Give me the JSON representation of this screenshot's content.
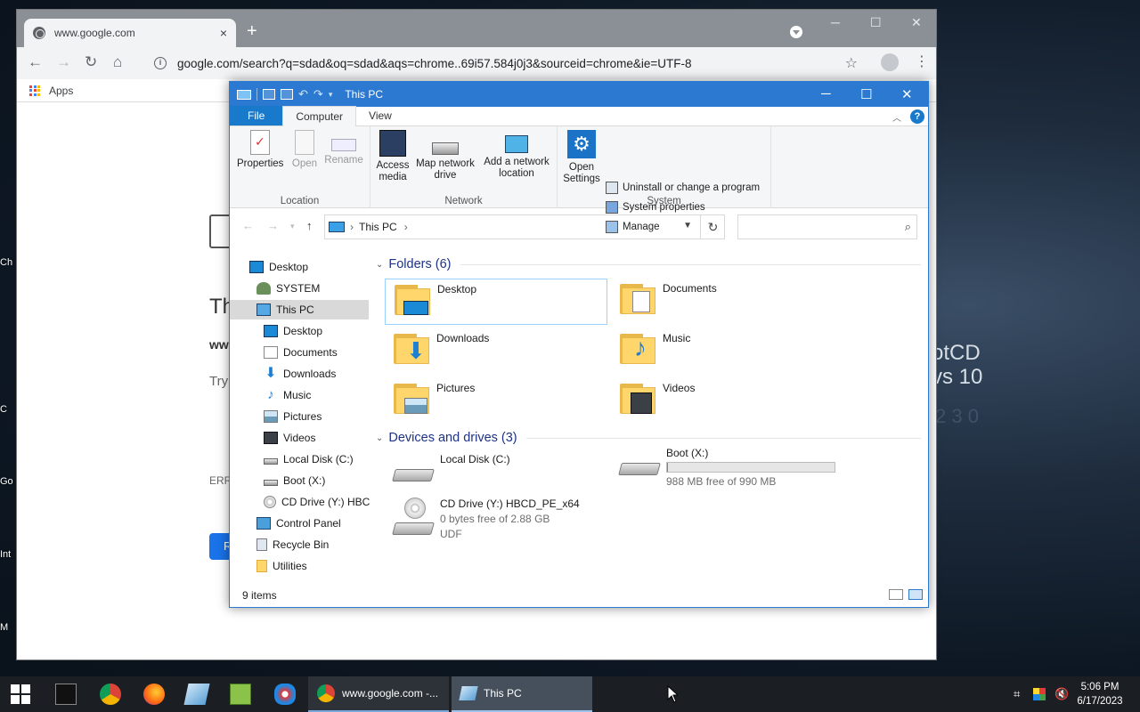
{
  "desktop": {
    "left_labels": [
      "Ch",
      "C",
      "Go",
      "Int",
      "M"
    ],
    "watermark_line1": "otCD",
    "watermark_line2": "vs 10",
    "faint_text": "2 3 0"
  },
  "chrome": {
    "tab_title": "www.google.com",
    "tab_close": "×",
    "new_tab": "+",
    "url": "google.com/search?q=sdad&oq=sdad&aqs=chrome..69i57.584j0j3&sourceid=chrome&ie=UTF-8",
    "bookmark_apps": "Apps",
    "page_fragments": {
      "heading": "Th",
      "line1": "ww",
      "line2": "Try:",
      "error": "ERR_",
      "button": "R"
    }
  },
  "explorer": {
    "title": "This PC",
    "tabs": [
      "File",
      "Computer",
      "View"
    ],
    "ribbon": {
      "location": {
        "label": "Location",
        "properties": "Properties",
        "open": "Open",
        "rename": "Rename"
      },
      "network": {
        "label": "Network",
        "access_media": "Access media",
        "map_drive": "Map network drive",
        "add_location": "Add a network location"
      },
      "system": {
        "label": "System",
        "open_settings": "Open Settings",
        "uninstall": "Uninstall or change a program",
        "sys_props": "System properties",
        "manage": "Manage"
      }
    },
    "address": {
      "crumb": "This PC"
    },
    "nav": [
      {
        "label": "Desktop",
        "icon": "desktop-icon"
      },
      {
        "label": "SYSTEM",
        "icon": "user-icon"
      },
      {
        "label": "This PC",
        "icon": "computer-icon"
      },
      {
        "label": "Desktop",
        "icon": "desktop-icon"
      },
      {
        "label": "Documents",
        "icon": "documents-icon"
      },
      {
        "label": "Downloads",
        "icon": "downloads-icon"
      },
      {
        "label": "Music",
        "icon": "music-icon"
      },
      {
        "label": "Pictures",
        "icon": "pictures-icon"
      },
      {
        "label": "Videos",
        "icon": "videos-icon"
      },
      {
        "label": "Local Disk (C:)",
        "icon": "drive-icon"
      },
      {
        "label": "Boot (X:)",
        "icon": "drive-icon"
      },
      {
        "label": "CD Drive (Y:) HBC",
        "icon": "cd-drive-icon"
      },
      {
        "label": "Control Panel",
        "icon": "control-panel-icon"
      },
      {
        "label": "Recycle Bin",
        "icon": "recycle-bin-icon"
      },
      {
        "label": "Utilities",
        "icon": "folder-icon"
      }
    ],
    "folders_header": "Folders (6)",
    "folders": [
      "Desktop",
      "Documents",
      "Downloads",
      "Music",
      "Pictures",
      "Videos"
    ],
    "devices_header": "Devices and drives (3)",
    "drives": {
      "c": {
        "name": "Local Disk (C:)"
      },
      "x": {
        "name": "Boot (X:)",
        "free": "988 MB free of 990 MB",
        "used_fraction": 0.002
      },
      "y": {
        "name": "CD Drive (Y:) HBCD_PE_x64",
        "free": "0 bytes free of 2.88 GB",
        "fs": "UDF"
      }
    },
    "status": "9 items"
  },
  "taskbar": {
    "win1": "www.google.com -...",
    "win2": "This PC",
    "time": "5:06 PM",
    "date": "6/17/2023"
  },
  "colors": {
    "accent": "#2b79d0",
    "folder": "#ffd66b",
    "progress": "#26a0da"
  }
}
